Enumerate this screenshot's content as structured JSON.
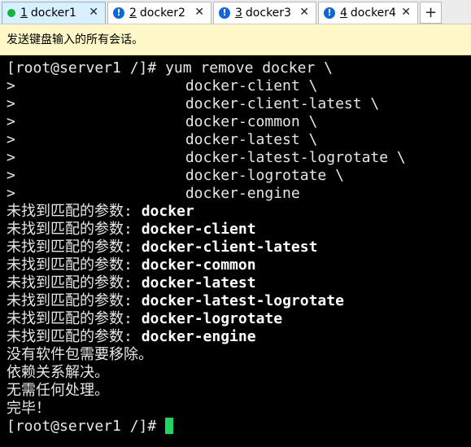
{
  "tabs": [
    {
      "index": "1",
      "title": "docker1",
      "active": true,
      "status": "connected",
      "close": "✕"
    },
    {
      "index": "2",
      "title": "docker2",
      "active": false,
      "status": "alert",
      "close": "✕"
    },
    {
      "index": "3",
      "title": "docker3",
      "active": false,
      "status": "alert",
      "close": "✕"
    },
    {
      "index": "4",
      "title": "docker4",
      "active": false,
      "status": "alert",
      "close": "✕"
    }
  ],
  "new_tab_label": "+",
  "alert_glyph": "!",
  "infobar": {
    "message": "发送键盘输入的所有会话。"
  },
  "terminal": {
    "command": "[root@server1 /]# yum remove docker \\",
    "continuation_prefix": ">",
    "continuation_args": [
      "docker-client \\",
      "docker-client-latest \\",
      "docker-common \\",
      "docker-latest \\",
      "docker-latest-logrotate \\",
      "docker-logrotate \\",
      "docker-engine"
    ],
    "no_match_prefix": "未找到匹配的参数: ",
    "no_match_packages": [
      "docker",
      "docker-client",
      "docker-client-latest",
      "docker-common",
      "docker-latest",
      "docker-latest-logrotate",
      "docker-logrotate",
      "docker-engine"
    ],
    "messages": [
      "没有软件包需要移除。",
      "依赖关系解决。",
      "无需任何处理。",
      "完毕！"
    ],
    "final_prompt": "[root@server1 /]# "
  },
  "colors": {
    "terminal_bg": "#000000",
    "cursor": "#1ed760",
    "active_tab": "#d8f0ff",
    "infobar_bg": "#fef7c7",
    "connected_dot": "#12b53d",
    "alert_icon": "#1167d4"
  }
}
